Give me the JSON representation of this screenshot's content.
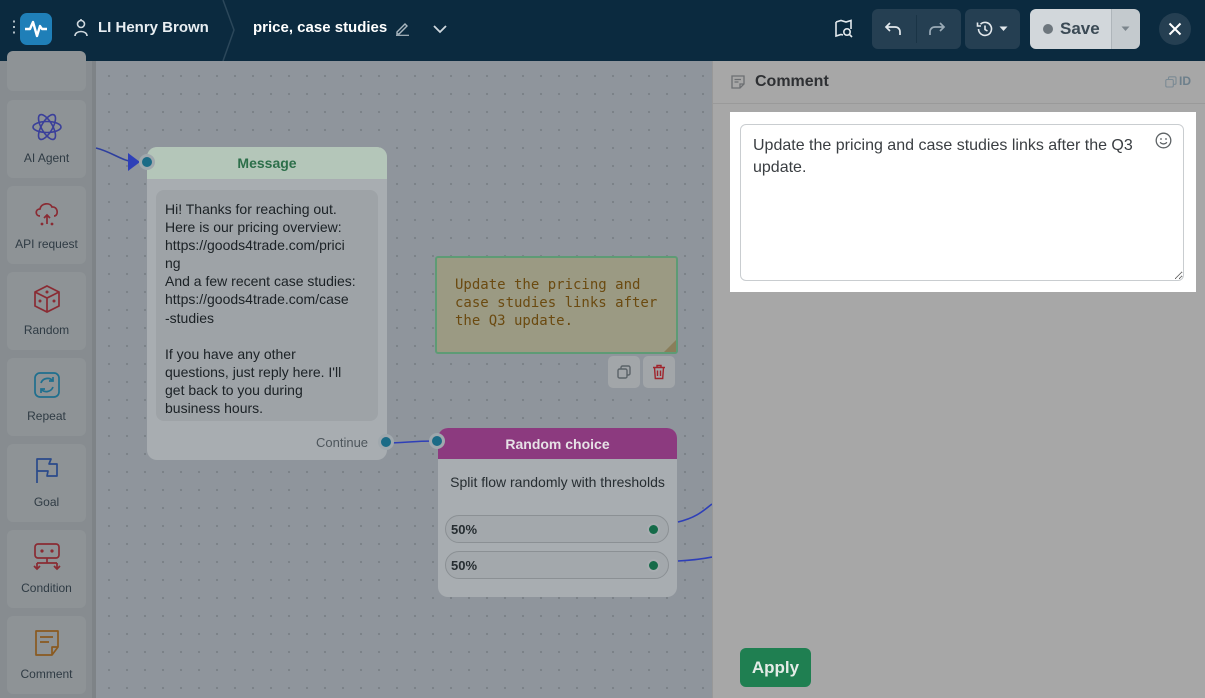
{
  "topbar": {
    "bot_name": "LI Henry Brown",
    "flow_name": "price, case studies",
    "save_label": "Save"
  },
  "sidebar": {
    "items": [
      {
        "label": "AI Agent",
        "icon": "ai-agent-icon"
      },
      {
        "label": "API request",
        "icon": "api-request-icon"
      },
      {
        "label": "Random",
        "icon": "dice-icon"
      },
      {
        "label": "Repeat",
        "icon": "repeat-icon"
      },
      {
        "label": "Goal",
        "icon": "flag-icon"
      },
      {
        "label": "Condition",
        "icon": "condition-icon"
      },
      {
        "label": "Comment",
        "icon": "comment-icon"
      }
    ]
  },
  "canvas": {
    "message_node": {
      "title": "Message",
      "lines": [
        "Hi! Thanks for reaching out.",
        "Here is our pricing overview:",
        "https://goods4trade.com/prici",
        "ng",
        "And a few recent case studies:",
        "https://goods4trade.com/case",
        "-studies",
        "",
        "If you have any other",
        "questions, just reply here. I'll",
        "get back to you during",
        "business hours."
      ],
      "continue_label": "Continue"
    },
    "comment_note": {
      "text": "Update the pricing and\ncase studies links after\nthe Q3 update."
    },
    "random_node": {
      "title": "Random choice",
      "description": "Split flow randomly with thresholds",
      "options": [
        {
          "value": "50%"
        },
        {
          "value": "50%"
        }
      ]
    }
  },
  "panel": {
    "title": "Comment",
    "id_label": "ID",
    "comment_text": "Update the pricing and case studies links after the Q3 update.",
    "apply_label": "Apply"
  },
  "colors": {
    "topbar": "#0b2a3f",
    "accent_green": "#1f7f51",
    "random_header": "#8c3a7f",
    "message_title": "#2d6f4a"
  }
}
